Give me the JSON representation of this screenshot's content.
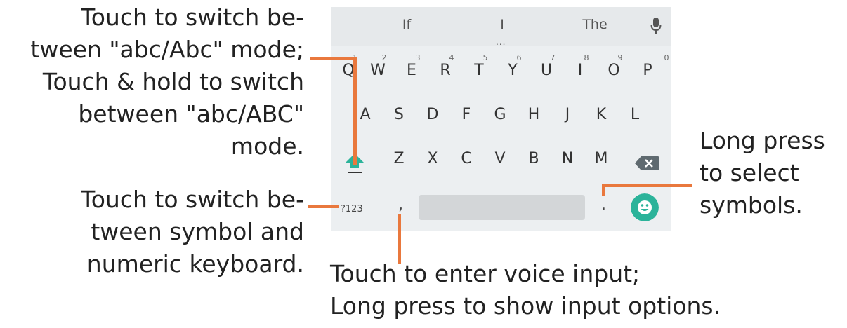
{
  "annotations": {
    "shift": [
      "Touch to switch  be-",
      "tween \"abc/Abc\" mode;",
      "Touch & hold to switch",
      "between \"abc/ABC\"",
      "mode."
    ],
    "symbol": [
      "Touch to switch be-",
      "tween symbol and",
      "numeric keyboard."
    ],
    "voice": [
      "Touch to enter voice input;",
      "Long press to show input options."
    ],
    "period": [
      "Long press",
      "to select",
      "symbols."
    ]
  },
  "keyboard": {
    "suggestions": [
      "If",
      "I",
      "The"
    ],
    "suggestion_more": "...",
    "row1": [
      "Q",
      "W",
      "E",
      "R",
      "T",
      "Y",
      "U",
      "I",
      "O",
      "P"
    ],
    "row1_hints": [
      "1",
      "2",
      "3",
      "4",
      "5",
      "6",
      "7",
      "8",
      "9",
      "0"
    ],
    "row2": [
      "A",
      "S",
      "D",
      "F",
      "G",
      "H",
      "J",
      "K",
      "L"
    ],
    "row3": [
      "Z",
      "X",
      "C",
      "V",
      "B",
      "N",
      "M"
    ],
    "symbol_key": "?123",
    "comma_key": ",",
    "period_key": "."
  },
  "colors": {
    "accent": "#e9783d",
    "shift_teal": "#2bb39a",
    "keyboard_bg": "#eceff1"
  },
  "icons": {
    "mic": "mic-icon",
    "shift": "shift-arrow-icon",
    "backspace": "backspace-icon",
    "emoji": "emoji-smile-icon"
  }
}
